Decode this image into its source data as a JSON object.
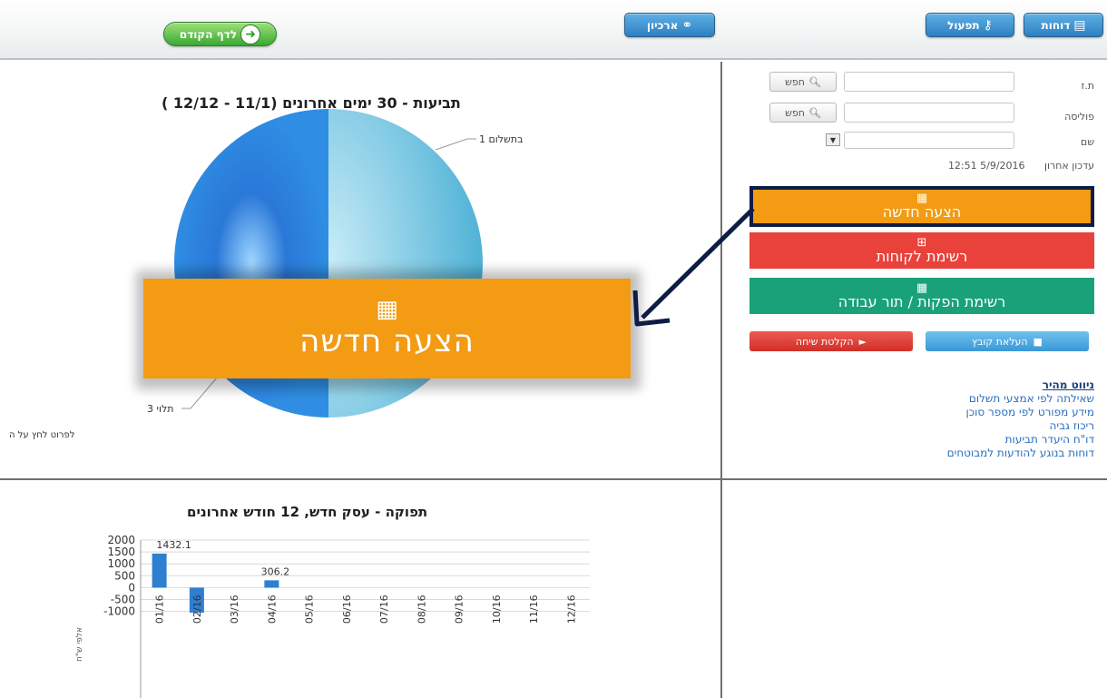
{
  "toolbar": {
    "reports_label": "דוחות",
    "operational_label": "תפעול",
    "archive_label": "ארכיון",
    "back_label": "לדף הקודם"
  },
  "search": {
    "id_label": "ת.ז",
    "policy_label": "פוליסה",
    "name_label": "שם",
    "search_button": "חפש",
    "last_update_label": "עדכון אחרון",
    "last_update_value": "12:51 5/9/2016"
  },
  "actions": {
    "new_offer_label": "הצעה חדשה",
    "customer_list_label": "רשימת לקוחות",
    "production_list_label": "רשימת הפקות / תור עבודה",
    "upload_file_label": "העלאת קובץ",
    "record_call_label": "הקלטת שיחה"
  },
  "quick_nav": {
    "title": "ניווט מהיר",
    "links": [
      "שאילתה לפי אמצעי תשלום",
      "מידע מפורט לפי מספר סוכן",
      "ריכוז גביה",
      "דו\"ח היעדר תביעות",
      "דוחות בנוגע להודעות למבוטחים"
    ]
  },
  "pie_chart": {
    "title": "תביעות - 30 ימים אחרונים (11/1 - 12/12 )",
    "note": "לפרוט לחץ על ה",
    "labels": [
      "בתשלום 1",
      "תלוי 3"
    ]
  },
  "popup": {
    "label": "הצעה חדשה"
  },
  "chart_data": {
    "type": "bar",
    "title": "תפוקה - עסק חדש, 12 חודש אחרונים",
    "ylabel": "אלפי ש\"ח",
    "categories": [
      "01/16",
      "02/16",
      "03/16",
      "04/16",
      "05/16",
      "06/16",
      "07/16",
      "08/16",
      "09/16",
      "10/16",
      "11/16",
      "12/16"
    ],
    "values": [
      1432.1,
      -1050,
      0,
      306.2,
      0,
      0,
      0,
      0,
      0,
      0,
      0,
      0
    ],
    "data_labels": [
      "1432.1",
      "",
      "",
      "306.2",
      "",
      "",
      "",
      "",
      "",
      "",
      "",
      ""
    ],
    "yticks": [
      2000,
      1500,
      1000,
      500,
      0,
      -500,
      -1000
    ],
    "ylim": [
      -1000,
      2000
    ],
    "grid": true,
    "bar_color": "#2f7fd0"
  },
  "colors": {
    "orange": "#f29b13",
    "red": "#e8423a",
    "teal": "#19a27a",
    "navy": "#0d1d45"
  }
}
